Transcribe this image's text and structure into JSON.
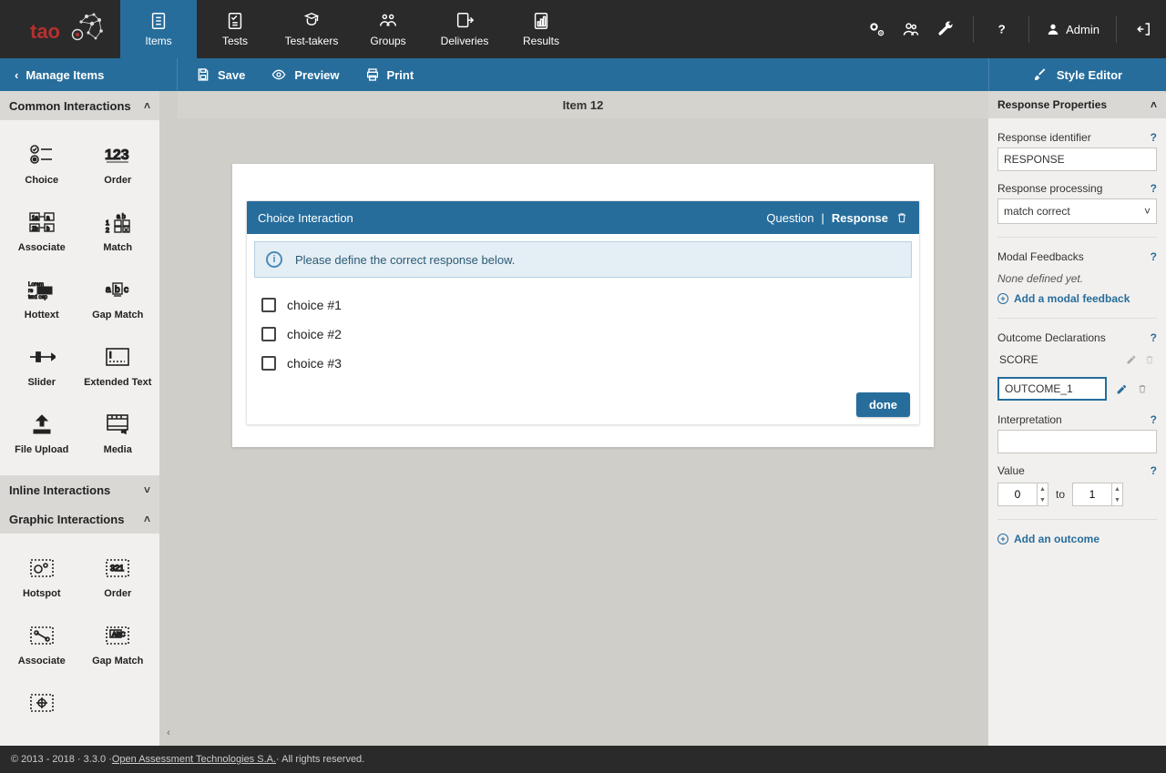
{
  "brand": {
    "name": "tao"
  },
  "nav": {
    "items": [
      "Items",
      "Tests",
      "Test-takers",
      "Groups",
      "Deliveries",
      "Results"
    ],
    "active_index": 0,
    "admin_label": "Admin"
  },
  "subbar": {
    "back_label": "Manage Items",
    "actions": {
      "save": "Save",
      "preview": "Preview",
      "print": "Print"
    },
    "style_editor": "Style Editor"
  },
  "left_panel": {
    "sections": {
      "common": {
        "title": "Common Interactions",
        "items": [
          "Choice",
          "Order",
          "Associate",
          "Match",
          "Hottext",
          "Gap Match",
          "Slider",
          "Extended Text",
          "File Upload",
          "Media"
        ]
      },
      "inline": {
        "title": "Inline Interactions"
      },
      "graphic": {
        "title": "Graphic Interactions",
        "items": [
          "Hotspot",
          "Order",
          "Associate",
          "Gap Match"
        ]
      }
    }
  },
  "canvas": {
    "item_title": "Item 12",
    "interaction_title": "Choice Interaction",
    "question_label": "Question",
    "response_label": "Response",
    "info_message": "Please define the correct response below.",
    "choices": [
      "choice #1",
      "choice #2",
      "choice #3"
    ],
    "done_label": "done"
  },
  "right": {
    "section_title": "Response Properties",
    "response_identifier_label": "Response identifier",
    "response_identifier_value": "RESPONSE",
    "response_processing_label": "Response processing",
    "response_processing_value": "match correct",
    "modal_feedbacks_label": "Modal Feedbacks",
    "none_defined": "None defined yet.",
    "add_modal_feedback": "Add a modal feedback",
    "outcome_declarations_label": "Outcome Declarations",
    "score_label": "SCORE",
    "outcome_value": "OUTCOME_1",
    "interpretation_label": "Interpretation",
    "interpretation_value": "",
    "value_label": "Value",
    "value_from": "0",
    "value_to_label": "to",
    "value_to": "1",
    "add_outcome": "Add an outcome"
  },
  "footer": {
    "left": "© 2013 - 2018 · 3.3.0 · ",
    "link_text": "Open Assessment Technologies S.A.",
    "right_text": " · All rights reserved."
  }
}
